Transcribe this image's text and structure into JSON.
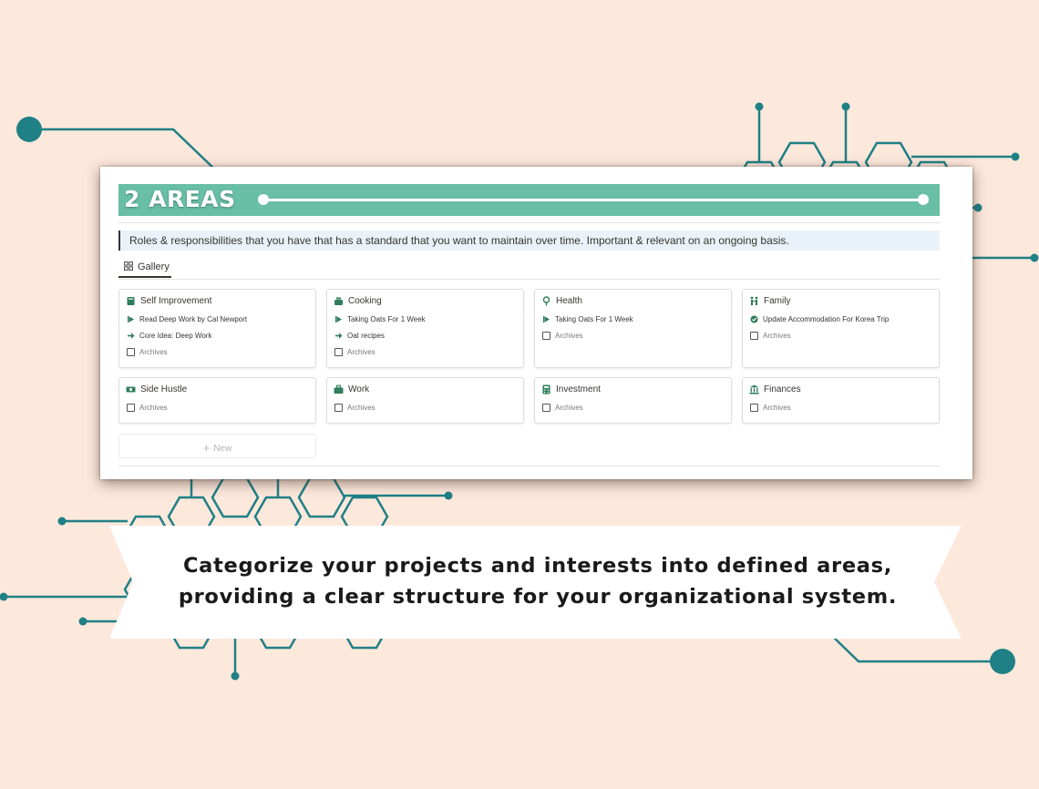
{
  "header": {
    "title": "2 AREAS"
  },
  "callout": {
    "text": "Roles & responsibilities that you have that has a standard that you want to maintain over time. Important & relevant on an ongoing basis."
  },
  "view": {
    "tab_label": "Gallery"
  },
  "cards": [
    {
      "title": "Self Improvement",
      "icon": "book-icon",
      "items": [
        {
          "label": "Read Deep Work by Cal Newport",
          "icon": "play-flag-icon"
        },
        {
          "label": "Core Idea: Deep Work",
          "icon": "arrow-right-icon"
        },
        {
          "label": "Archives",
          "icon": "checkbox"
        }
      ]
    },
    {
      "title": "Cooking",
      "icon": "pot-icon",
      "items": [
        {
          "label": "Taking Oats For 1 Week",
          "icon": "play-flag-icon"
        },
        {
          "label": "Oat recipes",
          "icon": "arrow-right-icon"
        },
        {
          "label": "Archives",
          "icon": "checkbox"
        }
      ]
    },
    {
      "title": "Health",
      "icon": "health-icon",
      "items": [
        {
          "label": "Taking Oats For 1 Week",
          "icon": "play-flag-icon"
        },
        {
          "label": "Archives",
          "icon": "checkbox"
        }
      ]
    },
    {
      "title": "Family",
      "icon": "family-icon",
      "items": [
        {
          "label": "Update Accommodation For Korea Trip",
          "icon": "check-circle-icon"
        },
        {
          "label": "Archives",
          "icon": "checkbox"
        }
      ]
    },
    {
      "title": "Side Hustle",
      "icon": "cash-icon",
      "items": [
        {
          "label": "Archives",
          "icon": "checkbox"
        }
      ]
    },
    {
      "title": "Work",
      "icon": "briefcase-icon",
      "items": [
        {
          "label": "Archives",
          "icon": "checkbox"
        }
      ]
    },
    {
      "title": "Investment",
      "icon": "calculator-icon",
      "items": [
        {
          "label": "Archives",
          "icon": "checkbox"
        }
      ]
    },
    {
      "title": "Finances",
      "icon": "bank-icon",
      "items": [
        {
          "label": "Archives",
          "icon": "checkbox"
        }
      ]
    }
  ],
  "new_button": {
    "label": "New"
  },
  "banner": {
    "line1": "Categorize your projects and interests into defined areas,",
    "line2": "providing a clear structure for your organizational system."
  },
  "colors": {
    "background": "#fde8dc",
    "accent": "#69bea6",
    "decoration": "#1f8086",
    "icon_green": "#2f7d5a"
  }
}
